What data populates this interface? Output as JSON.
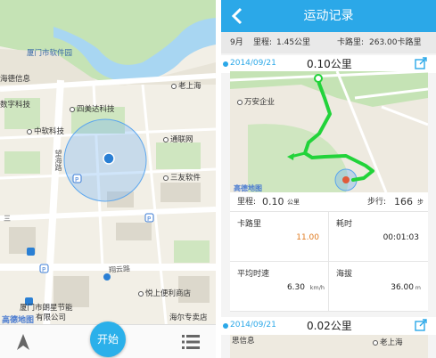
{
  "left": {
    "pois": {
      "software_park": "厦门市软件园",
      "lao_shanghai": "老上海",
      "haode_info": "海德信息",
      "digital_tech": "数字科技",
      "simeida": "四美达科技",
      "zhongruan": "中软科技",
      "tongliancang": "通联网",
      "sanyou": "三友软件",
      "yuexiang": "悦上便利商店",
      "haiershop": "海尔专卖店",
      "pengcheng_energy": "厦门市朗星节能",
      "corp_suffix": "有限公司"
    },
    "roads": {
      "wanghai": "望海路",
      "xiangyun": "翔云路",
      "fangshan_road": "三"
    },
    "map_watermark": "高德地图",
    "start_button": "开始",
    "icons": {
      "nav": "navigation-arrow-icon",
      "list": "list-icon"
    }
  },
  "right": {
    "title": "运动记录",
    "summary": {
      "month": "9月",
      "distance_label": "里程:",
      "distance_value": "1.45公里",
      "calorie_label": "卡路里:",
      "calorie_value": "263.00卡路里"
    },
    "records": [
      {
        "date": "2014/09/21",
        "distance": "0.10公里",
        "map_pois": {
          "company": "万安企业"
        },
        "map_watermark": "高德地图",
        "mileage_label": "里程:",
        "mileage_value": "0.10",
        "mileage_unit": "公里",
        "steps_label": "步行:",
        "steps_value": "166",
        "steps_unit": "步",
        "cells": {
          "calorie_label": "卡路里",
          "calorie_value": "11.00",
          "time_label": "耗时",
          "time_value": "00:01:03",
          "speed_label": "平均时速",
          "speed_value": "6.30",
          "speed_unit": "km/h",
          "altitude_label": "海拔",
          "altitude_value": "36.00",
          "altitude_unit": "m"
        }
      },
      {
        "date": "2014/09/21",
        "distance": "0.02公里",
        "map_pois": {
          "haode": "思信息",
          "lao_shanghai": "老上海"
        }
      }
    ],
    "colors": {
      "accent": "#2ba8e8",
      "calorie_value": "#e07a1f",
      "track": "#22d33a"
    }
  }
}
